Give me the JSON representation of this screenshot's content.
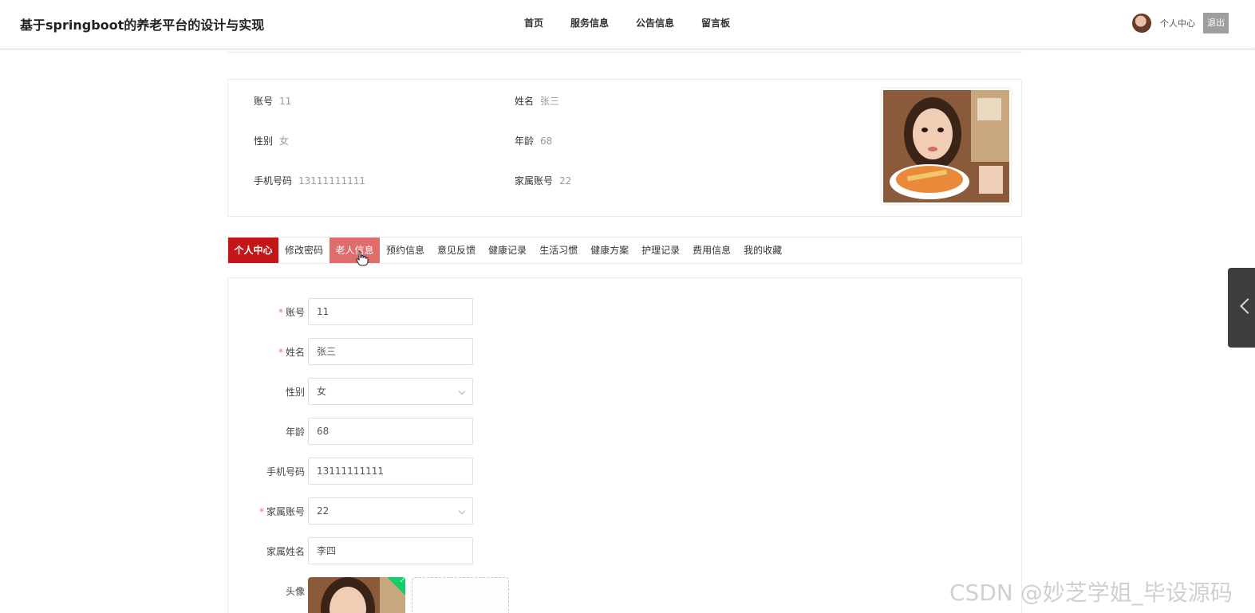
{
  "header": {
    "site_title": "基于springboot的养老平台的设计与实现",
    "nav": [
      "首页",
      "服务信息",
      "公告信息",
      "留言板"
    ],
    "user_center": "个人中心",
    "logout": "退出"
  },
  "profile": {
    "fields": [
      {
        "label": "账号",
        "value": "11"
      },
      {
        "label": "姓名",
        "value": "张三"
      },
      {
        "label": "性别",
        "value": "女"
      },
      {
        "label": "年龄",
        "value": "68"
      },
      {
        "label": "手机号码",
        "value": "13111111111"
      },
      {
        "label": "家属账号",
        "value": "22"
      }
    ]
  },
  "tabs": [
    "个人中心",
    "修改密码",
    "老人信息",
    "预约信息",
    "意见反馈",
    "健康记录",
    "生活习惯",
    "健康方案",
    "护理记录",
    "费用信息",
    "我的收藏"
  ],
  "form": {
    "fields": [
      {
        "label": "账号",
        "value": "11",
        "required": "*",
        "type": "input"
      },
      {
        "label": "姓名",
        "value": "张三",
        "required": "*",
        "type": "input"
      },
      {
        "label": "性别",
        "value": "女",
        "required": "",
        "type": "select"
      },
      {
        "label": "年龄",
        "value": "68",
        "required": "",
        "type": "input"
      },
      {
        "label": "手机号码",
        "value": "13111111111",
        "required": "",
        "type": "input"
      },
      {
        "label": "家属账号",
        "value": "22",
        "required": "*",
        "type": "select"
      },
      {
        "label": "家属姓名",
        "value": "李四",
        "required": "",
        "type": "input"
      }
    ],
    "avatar_label": "头像"
  },
  "watermark": "CSDN @妙芝学姐_毕设源码",
  "colors": {
    "accent": "#c41618",
    "tab_hover": "#e06c6c",
    "required": "#f56c6c"
  }
}
